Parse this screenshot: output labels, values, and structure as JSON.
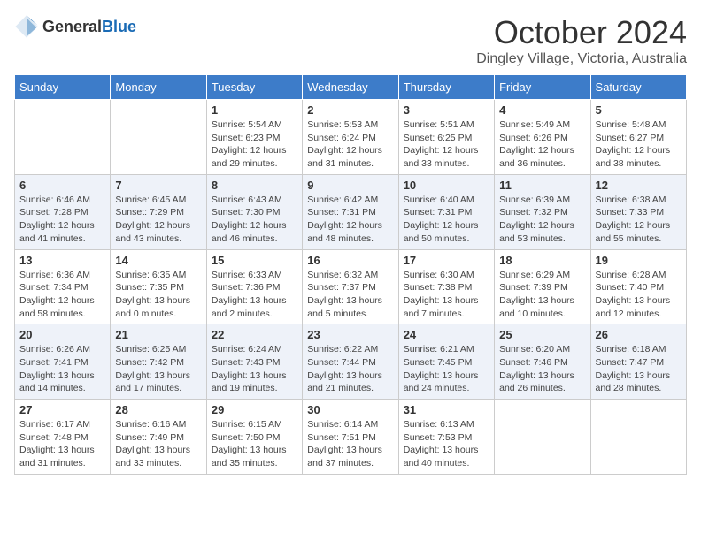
{
  "header": {
    "logo_general": "General",
    "logo_blue": "Blue",
    "month": "October 2024",
    "location": "Dingley Village, Victoria, Australia"
  },
  "days_of_week": [
    "Sunday",
    "Monday",
    "Tuesday",
    "Wednesday",
    "Thursday",
    "Friday",
    "Saturday"
  ],
  "weeks": [
    [
      {
        "day": "",
        "info": ""
      },
      {
        "day": "",
        "info": ""
      },
      {
        "day": "1",
        "info": "Sunrise: 5:54 AM\nSunset: 6:23 PM\nDaylight: 12 hours and 29 minutes."
      },
      {
        "day": "2",
        "info": "Sunrise: 5:53 AM\nSunset: 6:24 PM\nDaylight: 12 hours and 31 minutes."
      },
      {
        "day": "3",
        "info": "Sunrise: 5:51 AM\nSunset: 6:25 PM\nDaylight: 12 hours and 33 minutes."
      },
      {
        "day": "4",
        "info": "Sunrise: 5:49 AM\nSunset: 6:26 PM\nDaylight: 12 hours and 36 minutes."
      },
      {
        "day": "5",
        "info": "Sunrise: 5:48 AM\nSunset: 6:27 PM\nDaylight: 12 hours and 38 minutes."
      }
    ],
    [
      {
        "day": "6",
        "info": "Sunrise: 6:46 AM\nSunset: 7:28 PM\nDaylight: 12 hours and 41 minutes."
      },
      {
        "day": "7",
        "info": "Sunrise: 6:45 AM\nSunset: 7:29 PM\nDaylight: 12 hours and 43 minutes."
      },
      {
        "day": "8",
        "info": "Sunrise: 6:43 AM\nSunset: 7:30 PM\nDaylight: 12 hours and 46 minutes."
      },
      {
        "day": "9",
        "info": "Sunrise: 6:42 AM\nSunset: 7:31 PM\nDaylight: 12 hours and 48 minutes."
      },
      {
        "day": "10",
        "info": "Sunrise: 6:40 AM\nSunset: 7:31 PM\nDaylight: 12 hours and 50 minutes."
      },
      {
        "day": "11",
        "info": "Sunrise: 6:39 AM\nSunset: 7:32 PM\nDaylight: 12 hours and 53 minutes."
      },
      {
        "day": "12",
        "info": "Sunrise: 6:38 AM\nSunset: 7:33 PM\nDaylight: 12 hours and 55 minutes."
      }
    ],
    [
      {
        "day": "13",
        "info": "Sunrise: 6:36 AM\nSunset: 7:34 PM\nDaylight: 12 hours and 58 minutes."
      },
      {
        "day": "14",
        "info": "Sunrise: 6:35 AM\nSunset: 7:35 PM\nDaylight: 13 hours and 0 minutes."
      },
      {
        "day": "15",
        "info": "Sunrise: 6:33 AM\nSunset: 7:36 PM\nDaylight: 13 hours and 2 minutes."
      },
      {
        "day": "16",
        "info": "Sunrise: 6:32 AM\nSunset: 7:37 PM\nDaylight: 13 hours and 5 minutes."
      },
      {
        "day": "17",
        "info": "Sunrise: 6:30 AM\nSunset: 7:38 PM\nDaylight: 13 hours and 7 minutes."
      },
      {
        "day": "18",
        "info": "Sunrise: 6:29 AM\nSunset: 7:39 PM\nDaylight: 13 hours and 10 minutes."
      },
      {
        "day": "19",
        "info": "Sunrise: 6:28 AM\nSunset: 7:40 PM\nDaylight: 13 hours and 12 minutes."
      }
    ],
    [
      {
        "day": "20",
        "info": "Sunrise: 6:26 AM\nSunset: 7:41 PM\nDaylight: 13 hours and 14 minutes."
      },
      {
        "day": "21",
        "info": "Sunrise: 6:25 AM\nSunset: 7:42 PM\nDaylight: 13 hours and 17 minutes."
      },
      {
        "day": "22",
        "info": "Sunrise: 6:24 AM\nSunset: 7:43 PM\nDaylight: 13 hours and 19 minutes."
      },
      {
        "day": "23",
        "info": "Sunrise: 6:22 AM\nSunset: 7:44 PM\nDaylight: 13 hours and 21 minutes."
      },
      {
        "day": "24",
        "info": "Sunrise: 6:21 AM\nSunset: 7:45 PM\nDaylight: 13 hours and 24 minutes."
      },
      {
        "day": "25",
        "info": "Sunrise: 6:20 AM\nSunset: 7:46 PM\nDaylight: 13 hours and 26 minutes."
      },
      {
        "day": "26",
        "info": "Sunrise: 6:18 AM\nSunset: 7:47 PM\nDaylight: 13 hours and 28 minutes."
      }
    ],
    [
      {
        "day": "27",
        "info": "Sunrise: 6:17 AM\nSunset: 7:48 PM\nDaylight: 13 hours and 31 minutes."
      },
      {
        "day": "28",
        "info": "Sunrise: 6:16 AM\nSunset: 7:49 PM\nDaylight: 13 hours and 33 minutes."
      },
      {
        "day": "29",
        "info": "Sunrise: 6:15 AM\nSunset: 7:50 PM\nDaylight: 13 hours and 35 minutes."
      },
      {
        "day": "30",
        "info": "Sunrise: 6:14 AM\nSunset: 7:51 PM\nDaylight: 13 hours and 37 minutes."
      },
      {
        "day": "31",
        "info": "Sunrise: 6:13 AM\nSunset: 7:53 PM\nDaylight: 13 hours and 40 minutes."
      },
      {
        "day": "",
        "info": ""
      },
      {
        "day": "",
        "info": ""
      }
    ]
  ]
}
